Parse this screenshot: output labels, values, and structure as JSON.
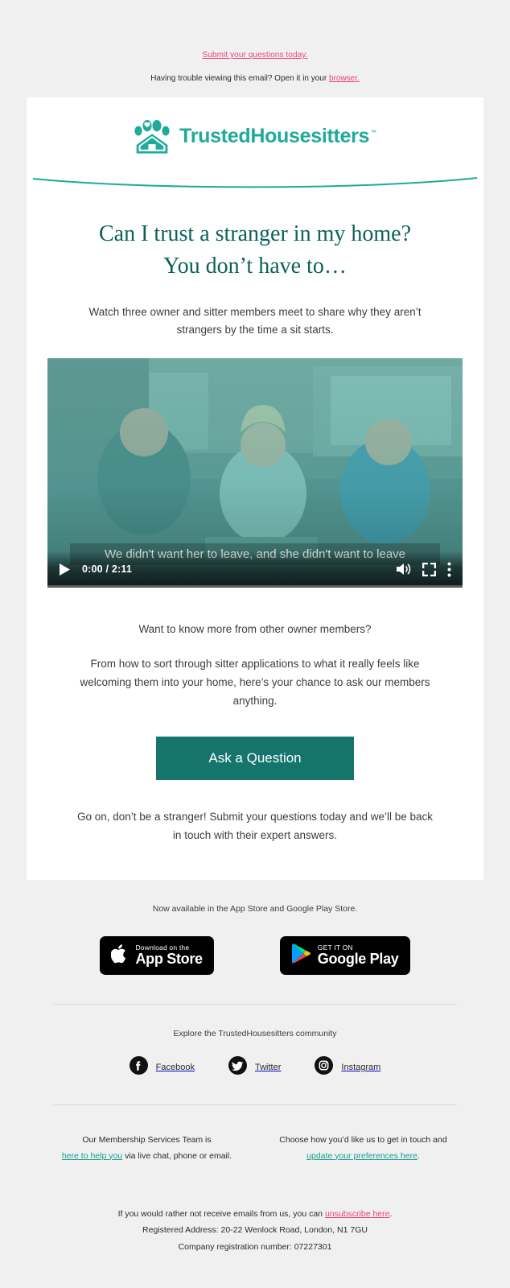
{
  "preheader": {
    "promo_text": "Submit your questions today.",
    "trouble_text": "Having trouble viewing this email? Open it in your ",
    "browser_link": "browser.",
    "link_color": "#e8447e"
  },
  "brand": {
    "name": "TrustedHousesitters",
    "trademark": "™",
    "logo_icon": "paw-house-logo",
    "teal": "#1faa9a",
    "dark_teal": "#0d6159",
    "cta_teal": "#15756b"
  },
  "hero": {
    "headline_line1": "Can I trust a stranger in my home?",
    "headline_line2": "You don’t have to…",
    "subhead": "Watch three owner and sitter members meet to share why they aren’t strangers by the time a sit starts."
  },
  "video": {
    "caption": "We didn't want her to leave, and she didn't want to leave",
    "current_time": "0:00",
    "separator": " / ",
    "duration": "2:11",
    "timestamp": "0:00 / 2:11",
    "play_icon": "play-icon",
    "volume_icon": "volume-icon",
    "fullscreen_icon": "fullscreen-icon",
    "menu_icon": "kebab-menu-icon",
    "progress_percent": 0
  },
  "body": {
    "question": "Want to know more from other owner members?",
    "paragraph": "From how to sort through sitter applications to what it really feels like welcoming them into your home, here’s your chance to ask our members anything.",
    "cta_label": "Ask a Question",
    "outro": "Go on, don’t be a stranger! Submit your questions today and we’ll be back in touch with their expert answers."
  },
  "apps": {
    "availability": "Now available in the App Store and Google Play Store.",
    "app_store": {
      "icon": "apple-icon",
      "small": "Download on the",
      "big": "App Store"
    },
    "google_play": {
      "icon": "google-play-icon",
      "small": "GET IT ON",
      "big": "Google Play"
    }
  },
  "community": {
    "heading": "Explore the TrustedHousesitters community",
    "socials": [
      {
        "label": "Facebook",
        "icon": "facebook-icon"
      },
      {
        "label": "Twitter",
        "icon": "twitter-icon"
      },
      {
        "label": "Instagram",
        "icon": "instagram-icon"
      }
    ]
  },
  "help": {
    "left_line1": "Our Membership Services Team is",
    "left_link": "here to help you",
    "left_line2": " via live chat, phone or email.",
    "right_line1": "Choose how you’d like us to get in touch and",
    "right_link": "update your preferences here",
    "right_line2": "."
  },
  "legal": {
    "unsub_prefix": "If you would rather not receive emails from us, you can ",
    "unsub_link": "unsubscribe here",
    "unsub_suffix": ".",
    "address": "Registered Address: 20-22 Wenlock Road, London, N1 7GU",
    "company": "Company registration number: 07227301"
  }
}
